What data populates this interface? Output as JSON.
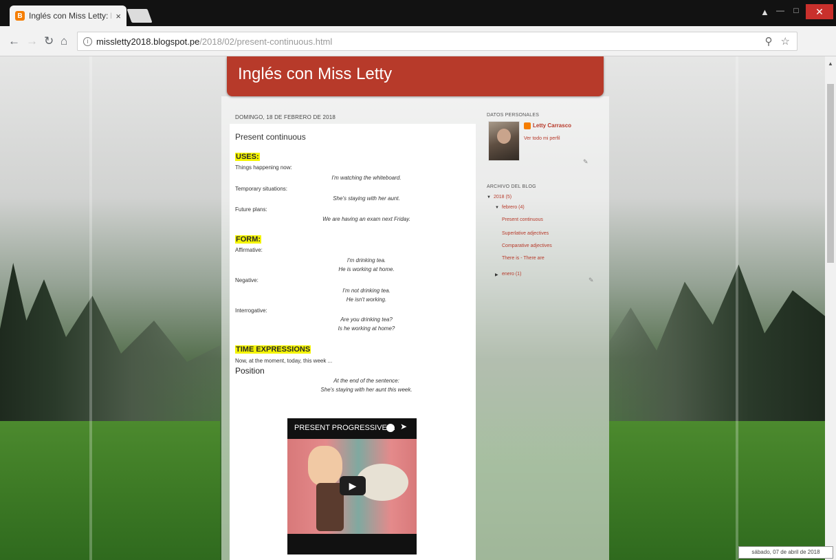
{
  "browser": {
    "tab_title": "Inglés con Miss Letty: Pr",
    "url_domain": "missletty2018.blogspot.pe",
    "url_path": "/2018/02/present-continuous.html",
    "tab_close": "×"
  },
  "blog": {
    "title": "Inglés con Miss Letty"
  },
  "post": {
    "date_header": "DOMINGO, 18 DE FEBRERO DE 2018",
    "title": "Present continuous",
    "uses_heading": "USES:",
    "uses": [
      {
        "label": "Things happening now:",
        "example": "I'm watching the whiteboard."
      },
      {
        "label": "Temporary situations:",
        "example": "She's staying with her aunt."
      },
      {
        "label": "Future plans:",
        "example": "We are having an exam next Friday."
      }
    ],
    "form_heading": "FORM:",
    "forms": [
      {
        "label": "Affirmative:",
        "examples": [
          "I'm drinking tea.",
          "He is working at home."
        ]
      },
      {
        "label": "Negative:",
        "examples": [
          "I'm not drinking tea.",
          "He isn't working."
        ]
      },
      {
        "label": "Interrogative:",
        "examples": [
          "Are you drinking tea?",
          "Is he working at home?"
        ]
      }
    ],
    "time_heading": "TIME EXPRESSIONS",
    "time_text": "Now, at the moment, today, this week ...",
    "position_heading": "Position",
    "position_examples": [
      "At the end of the sentence:",
      "She's staying with her aunt this week."
    ],
    "video_title": "PRESENT PROGRESSIVE ...",
    "video_play": "▶"
  },
  "sidebar": {
    "profile_heading": "DATOS PERSONALES",
    "profile_name": "Letty Carrasco",
    "profile_link": "Ver todo mi perfil",
    "archive_heading": "ARCHIVO DEL BLOG",
    "year": "2018 (5)",
    "month": "febrero (4)",
    "posts": [
      "Present continuous",
      "Superlative adjectives",
      "Comparative adjectives",
      "There is - There are"
    ],
    "month2": "enero (1)"
  },
  "clock_tip": "sábado, 07 de abril de 2018",
  "colors": {
    "header": "#b73a2a",
    "highlight": "#f4f400",
    "link": "#b73a2a"
  }
}
